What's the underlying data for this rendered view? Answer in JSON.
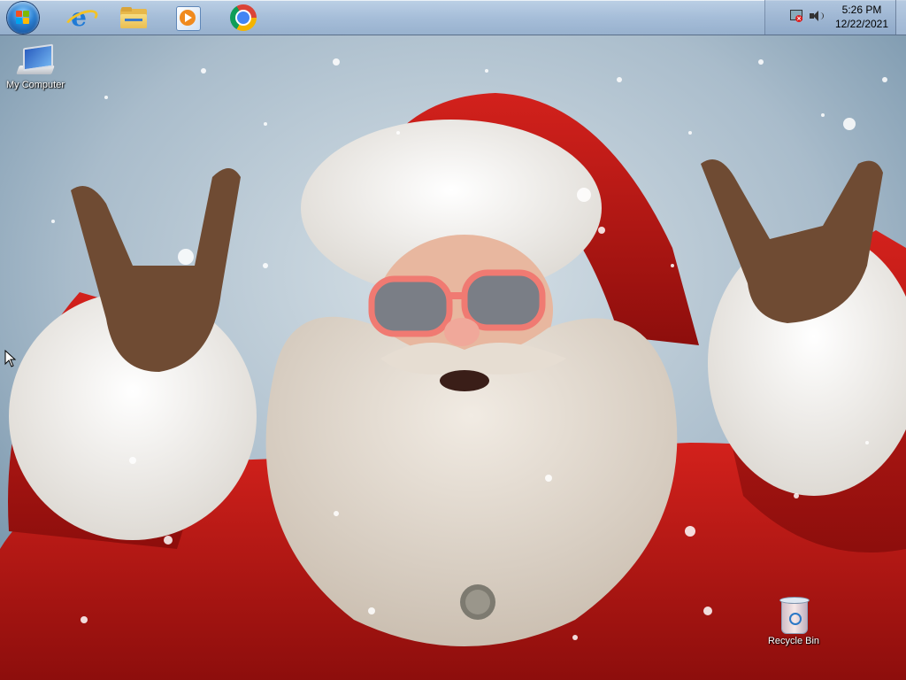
{
  "taskbar": {
    "start": {
      "icon": "windows-start-orb-icon"
    },
    "pinned": [
      {
        "name": "Internet Explorer",
        "icon": "internet-explorer-icon"
      },
      {
        "name": "Windows Explorer",
        "icon": "folder-icon"
      },
      {
        "name": "Windows Media Player",
        "icon": "media-player-icon"
      },
      {
        "name": "Google Chrome",
        "icon": "chrome-icon"
      }
    ],
    "tray": {
      "network_icon": "network-disconnected-icon",
      "volume_icon": "speaker-icon",
      "time": "5:26 PM",
      "date": "12/22/2021"
    }
  },
  "desktop": {
    "icons": [
      {
        "label": "My Computer",
        "icon": "computer-icon"
      },
      {
        "label": "Recycle Bin",
        "icon": "recycle-bin-icon"
      }
    ],
    "wallpaper": "santa-claus-wallpaper"
  }
}
